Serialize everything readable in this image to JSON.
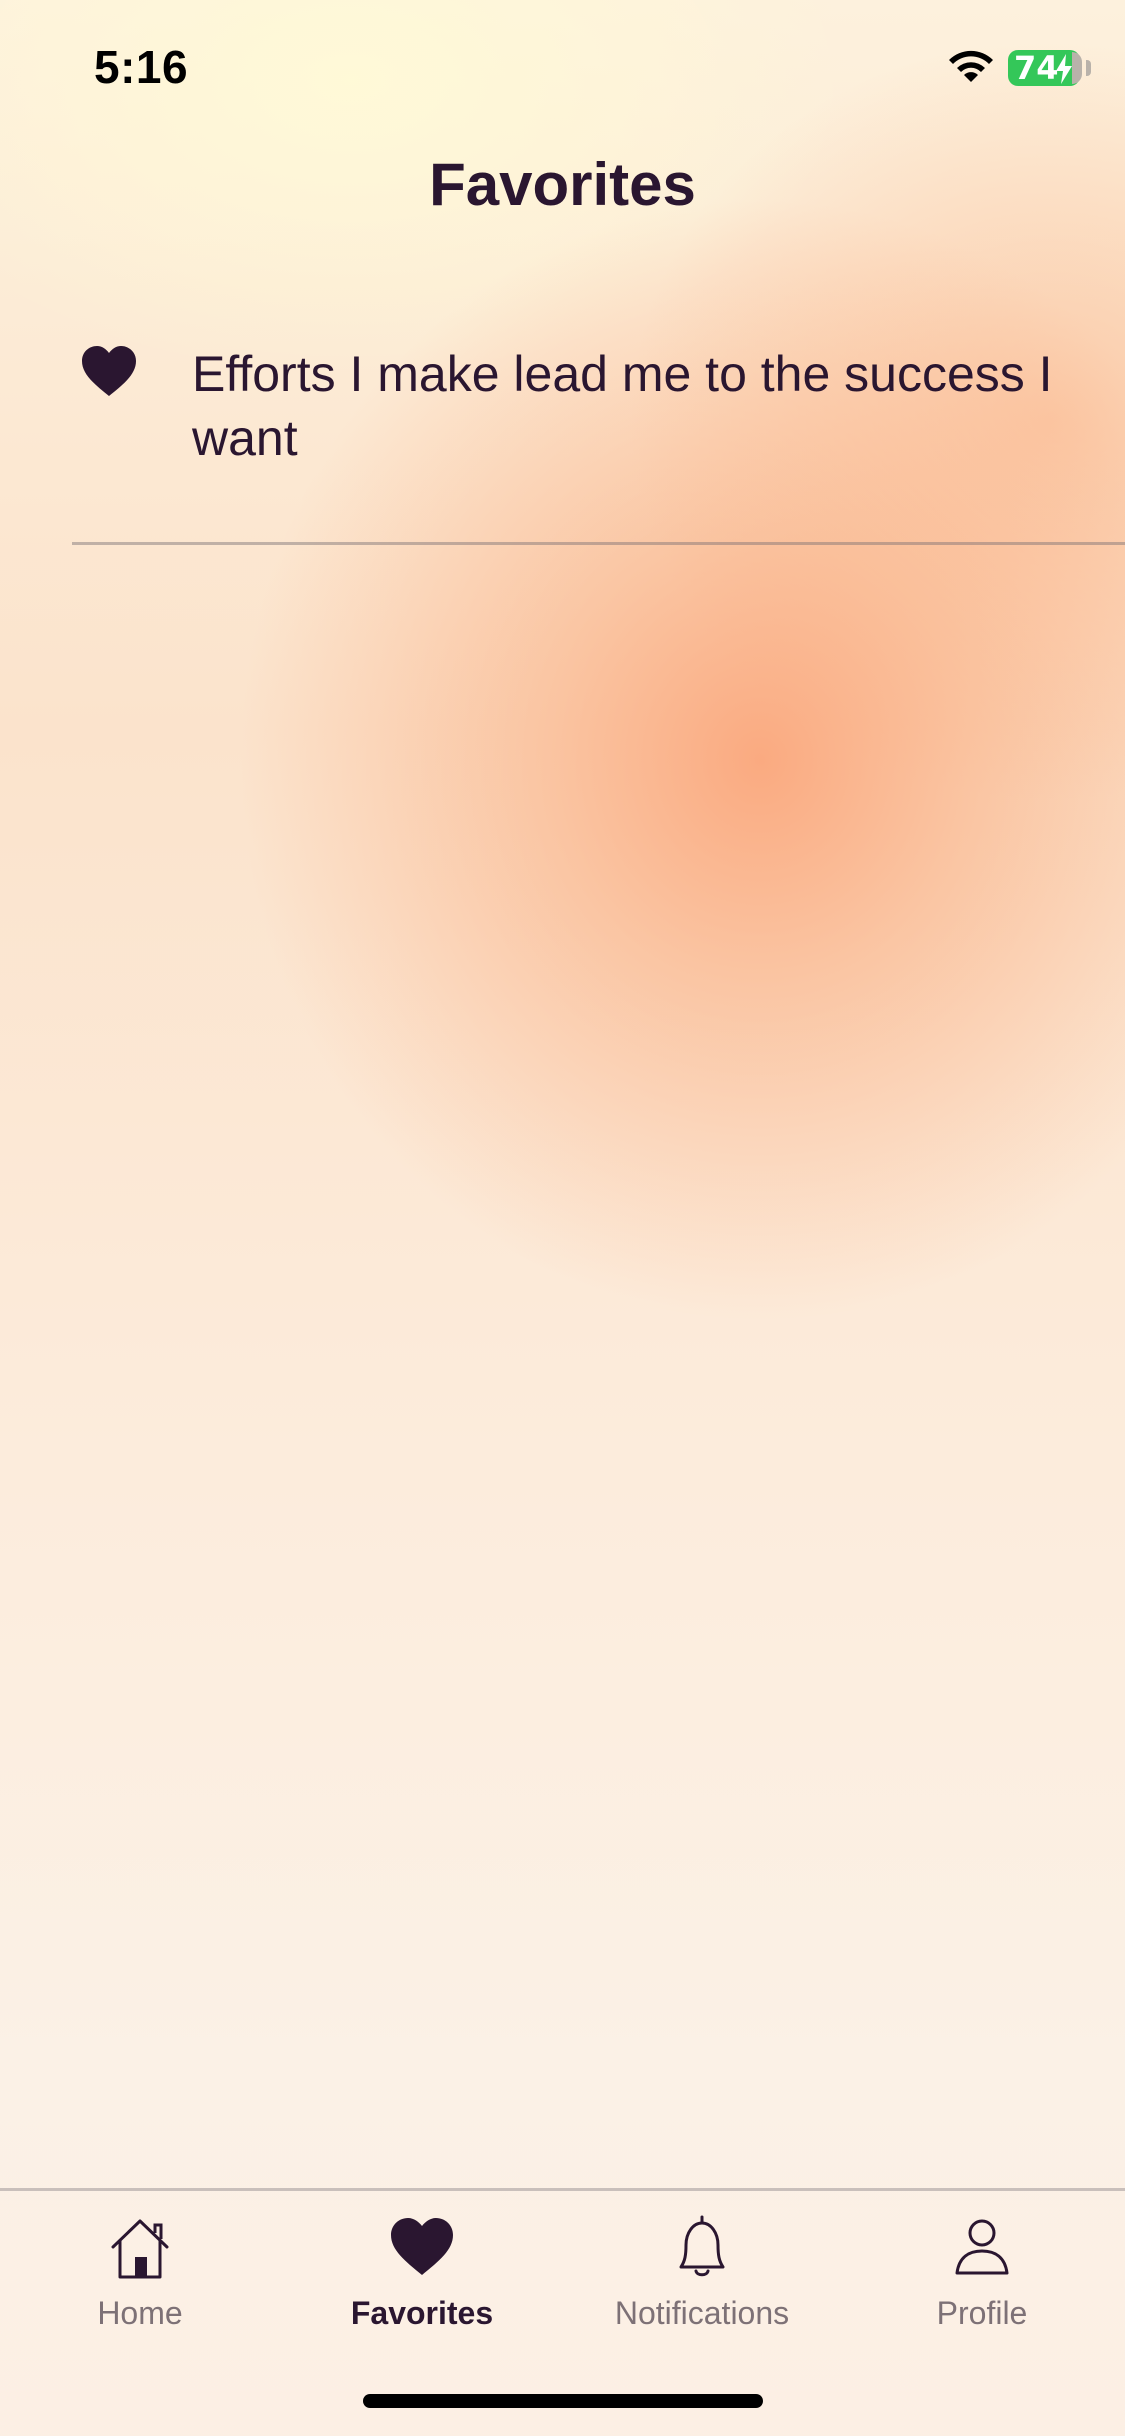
{
  "status_bar": {
    "time": "5:16",
    "battery_level": "74",
    "icons": [
      "wifi-icon",
      "battery-icon",
      "charging-bolt-icon"
    ],
    "battery_color": "#34c759"
  },
  "header": {
    "title": "Favorites"
  },
  "favorites": {
    "items": [
      {
        "text": "Efforts I make lead me to the success I want",
        "icon": "heart-icon"
      }
    ]
  },
  "tab_bar": {
    "active_tab": "Favorites",
    "tabs": [
      {
        "label": "Home",
        "icon": "home-icon"
      },
      {
        "label": "Favorites",
        "icon": "heart-icon"
      },
      {
        "label": "Notifications",
        "icon": "bell-icon"
      },
      {
        "label": "Profile",
        "icon": "person-icon"
      }
    ]
  },
  "colors": {
    "text_primary": "#2a1630",
    "tab_inactive": "#7d7176",
    "accent_gradient": "#faa073"
  }
}
